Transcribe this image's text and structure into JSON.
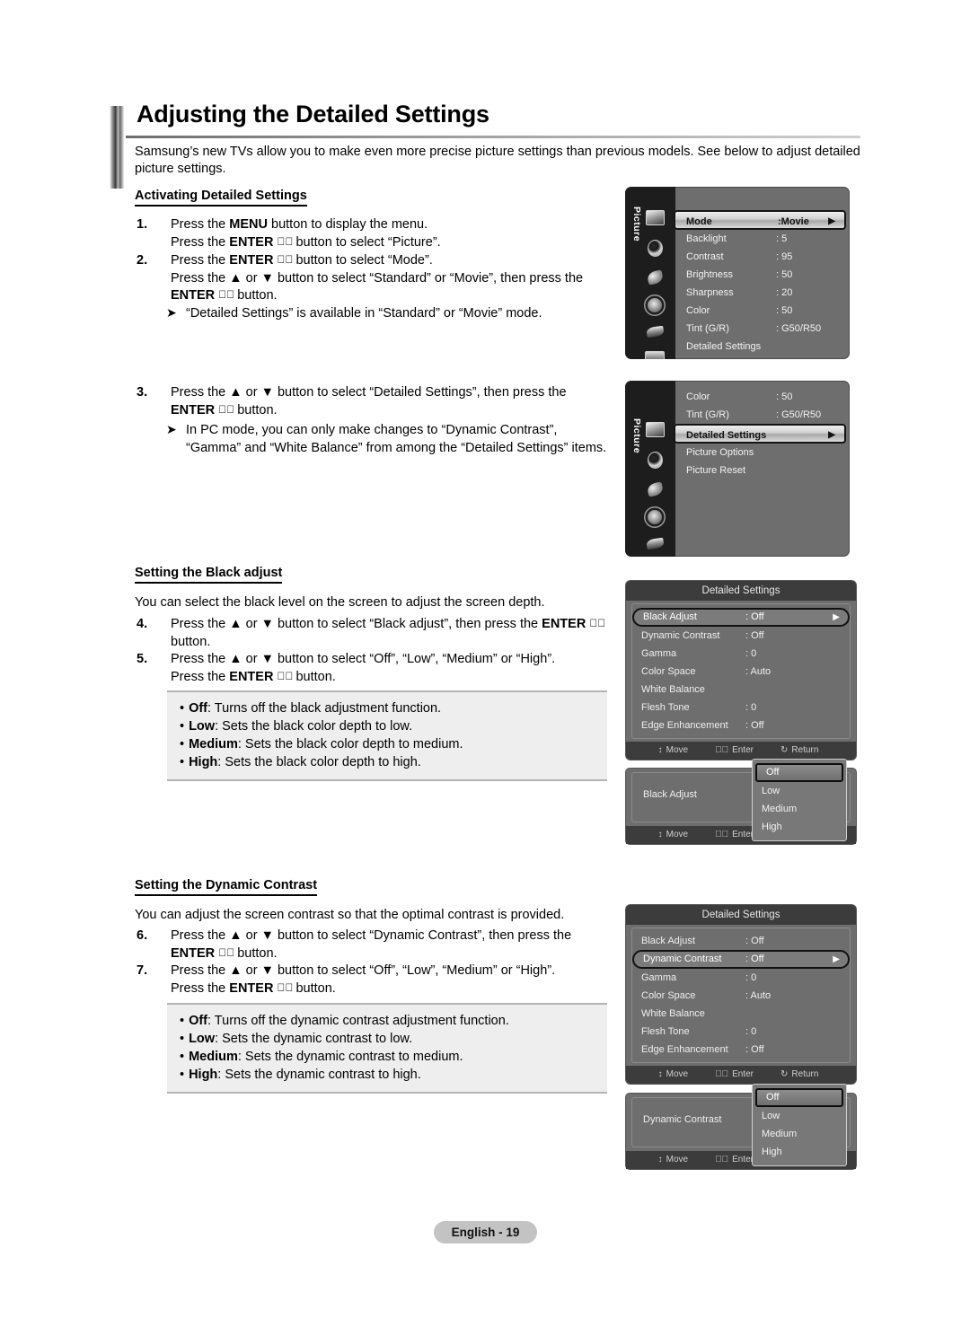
{
  "page": {
    "title": "Adjusting the Detailed Settings",
    "intro": "Samsung’s new TVs allow you to make even more precise picture settings than previous models. See below to adjust detailed picture settings.",
    "footer": "English - 19"
  },
  "sections": {
    "activating": {
      "heading": "Activating Detailed Settings",
      "steps": [
        {
          "num": "1.",
          "line1_a": "Press the ",
          "line1_b": "MENU",
          "line1_c": " button to display the menu.",
          "line2_a": "Press the ",
          "line2_b": "ENTER",
          "line2_icon": "enter-icon",
          "line2_c": " button to select “Picture”."
        },
        {
          "num": "2.",
          "line1_a": "Press the ",
          "line1_b": "ENTER",
          "line1_c": " button to select “Mode”.",
          "line2_a": "Press the ▲ or ▼ button to select “Standard” or “Movie”, then press the",
          "line3_b": "ENTER",
          "line3_c": " button."
        }
      ],
      "note": "“Detailed Settings” is available in “Standard” or “Movie” mode."
    },
    "step3": {
      "num": "3.",
      "line1": "Press the ▲ or ▼ button to select “Detailed Settings”, then press the",
      "line2_b": "ENTER",
      "line2_c": " button.",
      "note_line1": "In PC mode, you can only make changes to “Dynamic Contrast”,",
      "note_line2": "“Gamma” and “White Balance” from among the “Detailed Settings” items."
    },
    "black_adjust": {
      "heading": "Setting the Black adjust",
      "intro": "You can select the black level on the screen to adjust the screen depth.",
      "steps": [
        {
          "num": "4.",
          "line1_a": "Press the ▲ or ▼ button to select “Black adjust”, then press the ",
          "line1_b": "ENTER",
          "line2": "button."
        },
        {
          "num": "5.",
          "line1": "Press the ▲ or ▼ button to select “Off”, “Low”, “Medium” or “High”.",
          "line2_a": "Press the ",
          "line2_b": "ENTER",
          "line2_c": " button."
        }
      ],
      "options": [
        {
          "name": "Off",
          "desc": ": Turns off the black adjustment function."
        },
        {
          "name": "Low",
          "desc": ": Sets the black color depth to low."
        },
        {
          "name": "Medium",
          "desc": ": Sets the black color depth to medium."
        },
        {
          "name": "High",
          "desc": ": Sets the black color depth to high."
        }
      ]
    },
    "dynamic_contrast": {
      "heading": "Setting the Dynamic Contrast",
      "intro": "You can adjust the screen contrast so that the optimal contrast is provided.",
      "steps": [
        {
          "num": "6.",
          "line1": "Press the ▲ or ▼ button to select “Dynamic Contrast”, then press the",
          "line2_b": "ENTER",
          "line2_c": " button."
        },
        {
          "num": "7.",
          "line1": "Press the ▲ or ▼ button to select “Off”, “Low”, “Medium” or “High”.",
          "line2_a": "Press the ",
          "line2_b": "ENTER",
          "line2_c": " button."
        }
      ],
      "options": [
        {
          "name": "Off",
          "desc": ": Turns off the dynamic contrast adjustment function."
        },
        {
          "name": "Low",
          "desc": ": Sets the dynamic contrast to low."
        },
        {
          "name": "Medium",
          "desc": ": Sets the dynamic contrast to medium."
        },
        {
          "name": "High",
          "desc": ": Sets the dynamic contrast to high."
        }
      ]
    }
  },
  "osd": {
    "rail_label": "Picture",
    "icons": [
      "picture-icon",
      "sound-icon",
      "channel-icon",
      "setup-icon",
      "input-icon",
      "support-icon"
    ],
    "menu1": {
      "rows": [
        {
          "label": "Mode",
          "value": ":Movie",
          "selected": true,
          "caret": "▶"
        },
        {
          "label": "Backlight",
          "value": ": 5",
          "selected": false
        },
        {
          "label": "Contrast",
          "value": ": 95",
          "selected": false
        },
        {
          "label": "Brightness",
          "value": ": 50",
          "selected": false
        },
        {
          "label": "Sharpness",
          "value": ": 20",
          "selected": false
        },
        {
          "label": "Color",
          "value": ": 50",
          "selected": false
        },
        {
          "label": "Tint (G/R)",
          "value": ": G50/R50",
          "selected": false
        },
        {
          "label": "Detailed Settings",
          "value": "",
          "selected": false
        }
      ]
    },
    "menu2": {
      "rows": [
        {
          "label": "Color",
          "value": ": 50",
          "selected": false
        },
        {
          "label": "Tint (G/R)",
          "value": ": G50/R50",
          "selected": false
        },
        {
          "label": "Detailed Settings",
          "value": "",
          "selected": true,
          "caret": "▶"
        },
        {
          "label": "Picture Options",
          "value": "",
          "selected": false
        },
        {
          "label": "Picture Reset",
          "value": "",
          "selected": false
        }
      ]
    },
    "detailed_title": "Detailed Settings",
    "detailed_rows_black": [
      {
        "label": "Black Adjust",
        "value": ": Off",
        "selected": true,
        "caret": "▶"
      },
      {
        "label": "Dynamic Contrast",
        "value": ": Off",
        "selected": false
      },
      {
        "label": "Gamma",
        "value": ": 0",
        "selected": false
      },
      {
        "label": "Color Space",
        "value": ": Auto",
        "selected": false
      },
      {
        "label": "White Balance",
        "value": "",
        "selected": false
      },
      {
        "label": "Flesh Tone",
        "value": ": 0",
        "selected": false
      },
      {
        "label": "Edge Enhancement",
        "value": ": Off",
        "selected": false
      }
    ],
    "detailed_rows_dynamic": [
      {
        "label": "Black Adjust",
        "value": ": Off",
        "selected": false
      },
      {
        "label": "Dynamic Contrast",
        "value": ": Off",
        "selected": true,
        "caret": "▶"
      },
      {
        "label": "Gamma",
        "value": ": 0",
        "selected": false
      },
      {
        "label": "Color Space",
        "value": ": Auto",
        "selected": false
      },
      {
        "label": "White Balance",
        "value": "",
        "selected": false
      },
      {
        "label": "Flesh Tone",
        "value": ": 0",
        "selected": false
      },
      {
        "label": "Edge Enhancement",
        "value": ": Off",
        "selected": false
      }
    ],
    "hint": {
      "move": "Move",
      "enter": "Enter",
      "return": "Return"
    },
    "popup_black": {
      "label": "Black Adjust",
      "colon": ":",
      "options": [
        {
          "label": "Off",
          "selected": true
        },
        {
          "label": "Low",
          "selected": false
        },
        {
          "label": "Medium",
          "selected": false
        },
        {
          "label": "High",
          "selected": false
        }
      ]
    },
    "popup_dynamic": {
      "label": "Dynamic Contrast",
      "colon": ":",
      "options": [
        {
          "label": "Off",
          "selected": true
        },
        {
          "label": "Low",
          "selected": false
        },
        {
          "label": "Medium",
          "selected": false
        },
        {
          "label": "High",
          "selected": false
        }
      ]
    }
  }
}
